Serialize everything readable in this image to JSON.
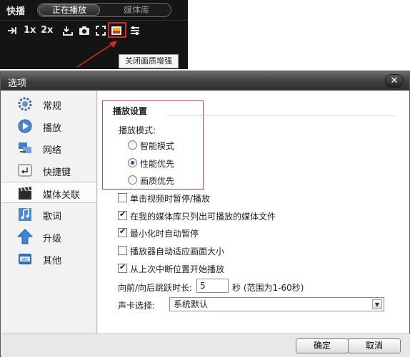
{
  "player": {
    "logo": "快播",
    "tabs": [
      "正在播放",
      "媒体库"
    ],
    "tools": {
      "skip_icon": "skip-forward-icon",
      "speed_1x": "1x",
      "speed_2x": "2x",
      "save_icon": "download-icon",
      "screenshot_icon": "camera-icon",
      "fullscreen_icon": "fullscreen-icon",
      "quality_icon": "picture-quality-icon",
      "more_icon": "settings-sliders-icon"
    },
    "tooltip": "关闭画质增强",
    "highlight_color": "#d92a22"
  },
  "dialog": {
    "title": "选项",
    "close_icon": "close-icon",
    "sidebar": [
      {
        "label": "常规",
        "icon": "gear-icon"
      },
      {
        "label": "播放",
        "icon": "play-icon"
      },
      {
        "label": "网络",
        "icon": "network-icon"
      },
      {
        "label": "快捷键",
        "icon": "keyboard-key-icon"
      },
      {
        "label": "媒体关联",
        "icon": "film-clapper-icon"
      },
      {
        "label": "歌词",
        "icon": "music-note-icon"
      },
      {
        "label": "升级",
        "icon": "upgrade-arrow-icon"
      },
      {
        "label": "其他",
        "icon": "etc-folder-icon"
      }
    ],
    "selected_item": "媒体关联",
    "content": {
      "section_title": "播放设置",
      "mode_label": "播放模式:",
      "modes": [
        "智能模式",
        "性能优先",
        "画质优先"
      ],
      "selected_mode": "性能优先",
      "options": [
        {
          "label": "单击视频时暂停/播放",
          "checked": false
        },
        {
          "label": "在我的媒体库只列出可播放的媒体文件",
          "checked": true
        },
        {
          "label": "最小化时自动暂停",
          "checked": true
        },
        {
          "label": "播放器自动适应画面大小",
          "checked": false
        },
        {
          "label": "从上次中断位置开始播放",
          "checked": true
        }
      ],
      "skip_label": "向前/向后跳跃时长:",
      "skip_value": "5",
      "skip_suffix": "秒 (范围为1-60秒)",
      "sound_label": "声卡选择:",
      "sound_value": "系统默认"
    },
    "buttons": {
      "ok": "确定",
      "cancel": "取消"
    }
  }
}
